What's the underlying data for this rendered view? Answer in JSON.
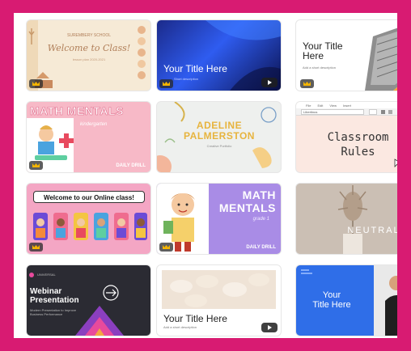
{
  "cards": {
    "c1": {
      "school": "SUREMBERY SCHOOL",
      "title": "Welcome to Class!",
      "sub": "lesson plan 2020-2021"
    },
    "c2": {
      "title": "Your Title Here",
      "desc": "Short description"
    },
    "c3": {
      "title": "Your Title Here",
      "desc": "Add a short description"
    },
    "c4": {
      "title": "MATH MENTALS",
      "sub": "kindergarten",
      "footer": "DAILY DRILL"
    },
    "c5": {
      "title1": "ADELINE",
      "title2": "PALMERSTON",
      "sub": "Creative Portfolio"
    },
    "c6": {
      "title1": "Classroom",
      "title2": "Rules",
      "menu": [
        "File",
        "Edit",
        "View",
        "Insert"
      ],
      "font": "Libertinus"
    },
    "c7": {
      "title": "Welcome to our Online class!"
    },
    "c8": {
      "title1": "MATH",
      "title2": "MENTALS",
      "sub": "grade 1",
      "footer": "DAILY DRILL"
    },
    "c9": {
      "title": "NEUTRAL"
    },
    "c10": {
      "brand": "UNIVERSAL",
      "title1": "Webinar",
      "title2": "Presentation",
      "sub": "Modern Presentation to Improve Business Performance"
    },
    "c11": {
      "title": "Your Title Here",
      "desc": "Add a short description"
    },
    "c12": {
      "title1": "Your",
      "title2": "Title Here"
    }
  },
  "colors": {
    "frame": "#d81b72",
    "accent_pink": "#f49ab4",
    "lilac": "#a98ce6"
  },
  "icons": {
    "premium": "crown-icon",
    "video": "play-icon"
  }
}
